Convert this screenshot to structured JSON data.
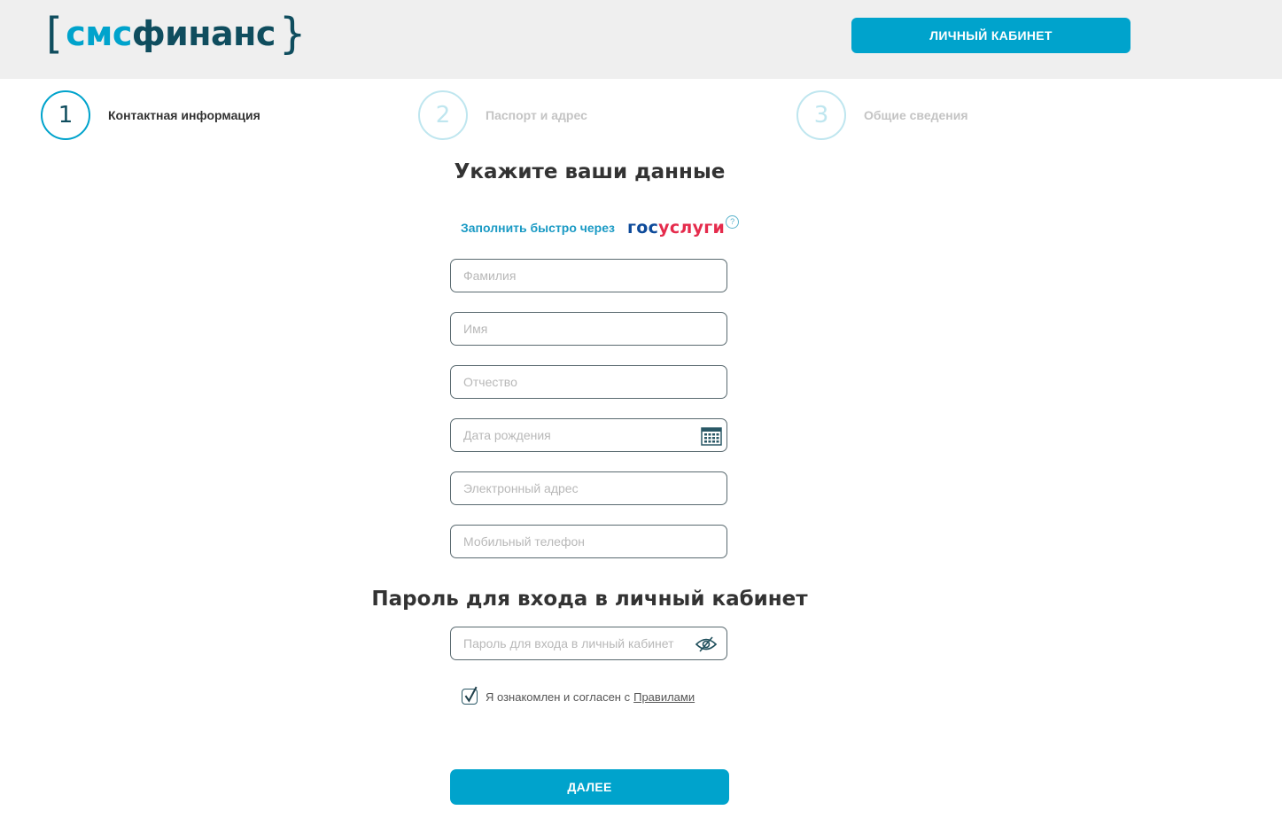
{
  "header": {
    "logo": {
      "open": "[",
      "part1": "смс",
      "part2": "финанс",
      "close": "}"
    },
    "cabinet_button": "ЛИЧНЫЙ КАБИНЕТ"
  },
  "steps": [
    {
      "number": "1",
      "label": "Контактная информация",
      "active": true
    },
    {
      "number": "2",
      "label": "Паспорт и адрес",
      "active": false
    },
    {
      "number": "3",
      "label": "Общие сведения",
      "active": false
    }
  ],
  "form": {
    "title": "Укажите ваши данные",
    "gosuslugi": {
      "link_text": "Заполнить быстро через",
      "logo_part1": "гос",
      "logo_part2": "услуги",
      "help": "?"
    },
    "fields": {
      "last_name": {
        "placeholder": "Фамилия",
        "value": ""
      },
      "first_name": {
        "placeholder": "Имя",
        "value": ""
      },
      "middle_name": {
        "placeholder": "Отчество",
        "value": ""
      },
      "birth_date": {
        "placeholder": "Дата рождения",
        "value": ""
      },
      "email": {
        "placeholder": "Электронный адрес",
        "value": ""
      },
      "phone": {
        "placeholder": "Мобильный телефон",
        "value": ""
      }
    },
    "password_title": "Пароль для входа в личный кабинет",
    "password": {
      "placeholder": "Пароль для входа в личный кабинет",
      "value": ""
    },
    "agree": {
      "checked": true,
      "text": "Я ознакомлен и согласен с",
      "link": "Правилами"
    },
    "next_button": "ДАЛЕЕ"
  },
  "colors": {
    "accent": "#00a3cc",
    "dark": "#0f4d5e",
    "header_bg": "#efefef",
    "gos_blue": "#0d4a9a",
    "gos_red": "#e52b4c"
  },
  "icons": {
    "calendar": "calendar-icon",
    "eye": "eye-crossed-icon",
    "help": "question-circle-icon",
    "check": "checkmark-icon"
  }
}
